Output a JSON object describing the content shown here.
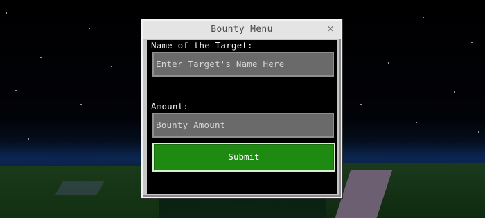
{
  "dialog": {
    "title": "Bounty Menu",
    "close_label": "×"
  },
  "form": {
    "target_label": "Name of the Target:",
    "target_placeholder": "Enter Target's Name Here",
    "amount_label": "Amount:",
    "amount_placeholder": "Bounty Amount",
    "submit_label": "Submit"
  },
  "colors": {
    "submit_green": "#1f8a12",
    "input_gray": "#6a6a6a",
    "dialog_frame": "#c6c6c6"
  }
}
